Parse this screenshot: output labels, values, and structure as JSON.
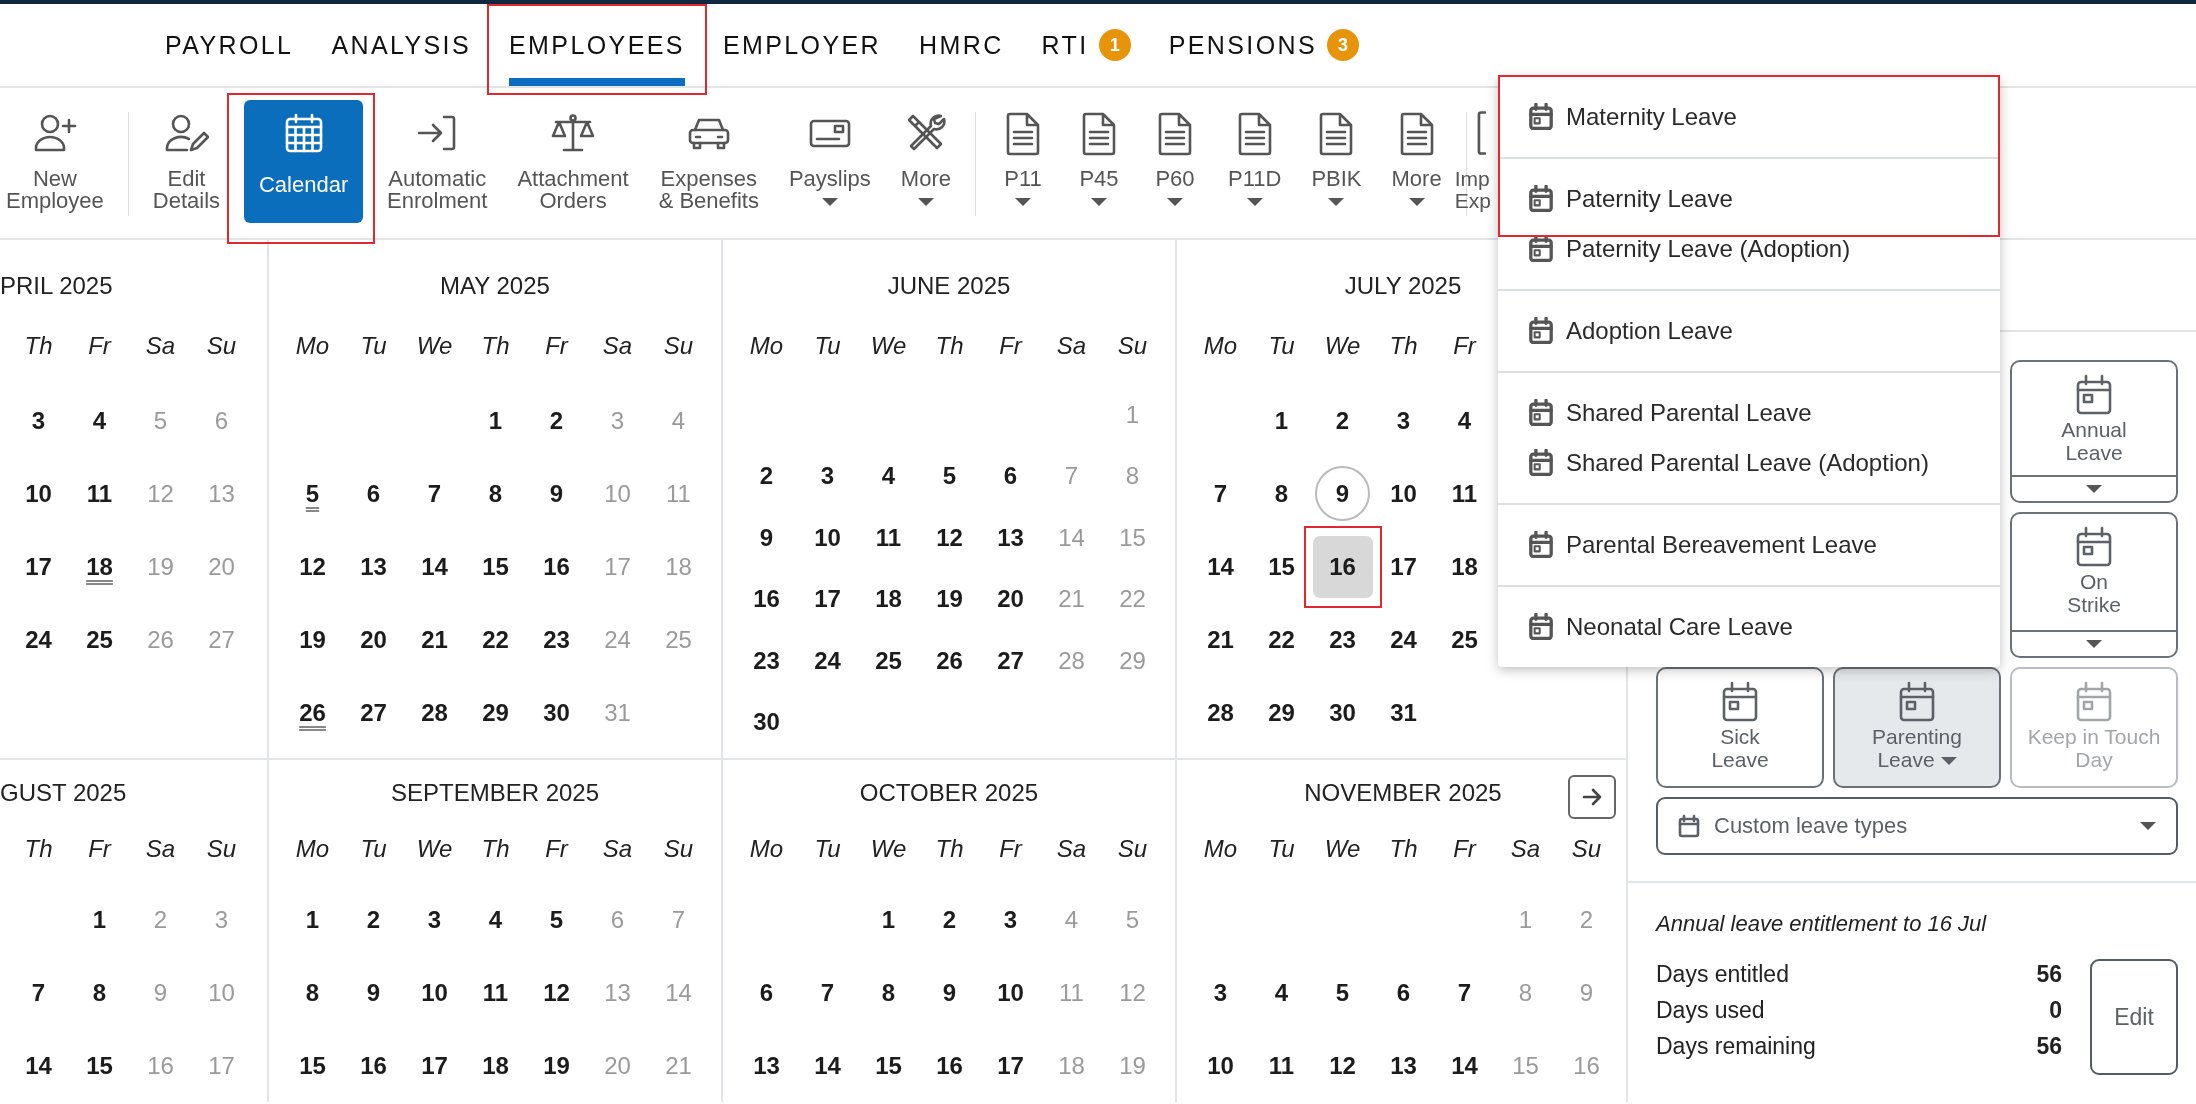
{
  "nav": {
    "tabs": [
      {
        "label": "PAYROLL",
        "selected": false,
        "highlighted": false
      },
      {
        "label": "ANALYSIS",
        "selected": false,
        "highlighted": false
      },
      {
        "label": "EMPLOYEES",
        "selected": true,
        "highlighted": true
      },
      {
        "label": "EMPLOYER",
        "selected": false,
        "highlighted": false
      },
      {
        "label": "HMRC",
        "selected": false,
        "highlighted": false
      },
      {
        "label": "RTI",
        "selected": false,
        "highlighted": false,
        "badge": "1"
      },
      {
        "label": "PENSIONS",
        "selected": false,
        "highlighted": false,
        "badge": "3"
      }
    ]
  },
  "toolbar": {
    "groups": [
      [
        {
          "label": "New\nEmployee",
          "selected": false,
          "dropdown": false,
          "highlighted": false
        }
      ],
      [
        {
          "label": "Edit\nDetails",
          "selected": false,
          "dropdown": false,
          "highlighted": false
        },
        {
          "label": "Calendar",
          "selected": true,
          "dropdown": false,
          "highlighted": true
        },
        {
          "label": "Automatic\nEnrolment",
          "selected": false,
          "dropdown": false,
          "highlighted": false
        },
        {
          "label": "Attachment\nOrders",
          "selected": false,
          "dropdown": false,
          "highlighted": false
        },
        {
          "label": "Expenses\n& Benefits",
          "selected": false,
          "dropdown": false,
          "highlighted": false
        },
        {
          "label": "Payslips",
          "selected": false,
          "dropdown": true,
          "highlighted": false
        },
        {
          "label": "More",
          "selected": false,
          "dropdown": true,
          "highlighted": false
        }
      ],
      [
        {
          "label": "P11",
          "selected": false,
          "dropdown": true,
          "highlighted": false
        },
        {
          "label": "P45",
          "selected": false,
          "dropdown": true,
          "highlighted": false
        },
        {
          "label": "P60",
          "selected": false,
          "dropdown": true,
          "highlighted": false
        },
        {
          "label": "P11D",
          "selected": false,
          "dropdown": true,
          "highlighted": false
        },
        {
          "label": "PBIK",
          "selected": false,
          "dropdown": true,
          "highlighted": false
        },
        {
          "label": "More",
          "selected": false,
          "dropdown": true,
          "highlighted": false
        }
      ],
      [
        {
          "label": "Imp\nExp",
          "selected": false,
          "dropdown": false,
          "highlighted": false
        }
      ]
    ]
  },
  "calendar": {
    "rows": [
      {
        "months": [
          {
            "title": "PRIL 2025",
            "weekdays": [
              {
                "label": "Th",
                "weekend": false
              },
              {
                "label": "Fr",
                "weekend": false
              },
              {
                "label": "Sa",
                "weekend": true
              },
              {
                "label": "Su",
                "weekend": true
              }
            ],
            "weeks": [
              [
                "3",
                "4",
                "5",
                "6"
              ],
              [
                "10",
                "11",
                "12",
                "13"
              ],
              [
                "17",
                {
                  "day": "18",
                  "holiday": true,
                  "selected": false
                },
                "19",
                "20"
              ],
              [
                "24",
                "25",
                "26",
                "27"
              ]
            ]
          },
          {
            "title": "MAY 2025",
            "weekdays": [
              {
                "label": "Mo",
                "weekend": false
              },
              {
                "label": "Tu",
                "weekend": false
              },
              {
                "label": "We",
                "weekend": false
              },
              {
                "label": "Th",
                "weekend": false
              },
              {
                "label": "Fr",
                "weekend": false
              },
              {
                "label": "Sa",
                "weekend": true
              },
              {
                "label": "Su",
                "weekend": true
              }
            ],
            "weeks": [
              [
                "1",
                "2",
                "3",
                "4"
              ],
              [
                {
                  "day": "5",
                  "holiday": true,
                  "selected": false
                },
                "6",
                "7",
                "8",
                "9",
                "10",
                "11"
              ],
              [
                "12",
                "13",
                "14",
                "15",
                "16",
                "17",
                "18"
              ],
              [
                "19",
                "20",
                "21",
                "22",
                "23",
                "24",
                "25"
              ],
              [
                {
                  "day": "26",
                  "holiday": true,
                  "selected": false
                },
                "27",
                "28",
                "29",
                "30",
                "31"
              ]
            ]
          },
          {
            "title": "JUNE 2025",
            "weekdays": [
              {
                "label": "Mo",
                "weekend": false
              },
              {
                "label": "Tu",
                "weekend": false
              },
              {
                "label": "We",
                "weekend": false
              },
              {
                "label": "Th",
                "weekend": false
              },
              {
                "label": "Fr",
                "weekend": false
              },
              {
                "label": "Sa",
                "weekend": true
              },
              {
                "label": "Su",
                "weekend": true
              }
            ],
            "weeks": [
              [
                "1"
              ],
              [
                "2",
                "3",
                "4",
                "5",
                "6",
                "7",
                "8"
              ],
              [
                "9",
                "10",
                "11",
                "12",
                "13",
                "14",
                "15"
              ],
              [
                "16",
                "17",
                "18",
                "19",
                "20",
                "21",
                "22"
              ],
              [
                "23",
                "24",
                "25",
                "26",
                "27",
                "28",
                "29"
              ],
              [
                "30"
              ]
            ]
          },
          {
            "title": "JULY 2025",
            "weekdays": [
              {
                "label": "Mo",
                "weekend": false
              },
              {
                "label": "Tu",
                "weekend": false
              },
              {
                "label": "We",
                "weekend": false
              },
              {
                "label": "Th",
                "weekend": false
              },
              {
                "label": "Fr",
                "weekend": false
              }
            ],
            "weeks": [
              [
                "1",
                "2",
                "3",
                "4"
              ],
              [
                "7",
                "8",
                {
                  "day": "9",
                  "today": true,
                  "selected": false
                },
                "10",
                "11"
              ],
              [
                "14",
                "15",
                {
                  "day": "16",
                  "selected": true,
                  "highlighted": true
                },
                "17",
                "18"
              ],
              [
                "21",
                "22",
                "23",
                "24",
                "25"
              ],
              [
                "28",
                "29",
                "30",
                "31"
              ]
            ]
          }
        ]
      },
      {
        "months": [
          {
            "title": "GUST 2025",
            "weekdays": [
              {
                "label": "Th",
                "weekend": false
              },
              {
                "label": "Fr",
                "weekend": false
              },
              {
                "label": "Sa",
                "weekend": true
              },
              {
                "label": "Su",
                "weekend": true
              }
            ],
            "weeks": [
              [
                "1",
                "2",
                "3"
              ],
              [
                "7",
                "8",
                "9",
                "10"
              ],
              [
                "14",
                "15",
                "16",
                "17"
              ]
            ]
          },
          {
            "title": "SEPTEMBER 2025",
            "weekdays": [
              {
                "label": "Mo",
                "weekend": false
              },
              {
                "label": "Tu",
                "weekend": false
              },
              {
                "label": "We",
                "weekend": false
              },
              {
                "label": "Th",
                "weekend": false
              },
              {
                "label": "Fr",
                "weekend": false
              },
              {
                "label": "Sa",
                "weekend": true
              },
              {
                "label": "Su",
                "weekend": true
              }
            ],
            "weeks": [
              [
                "1",
                "2",
                "3",
                "4",
                "5",
                "6",
                "7"
              ],
              [
                "8",
                "9",
                "10",
                "11",
                "12",
                "13",
                "14"
              ],
              [
                "15",
                "16",
                "17",
                "18",
                "19",
                "20",
                "21"
              ]
            ]
          },
          {
            "title": "OCTOBER 2025",
            "weekdays": [
              {
                "label": "Mo",
                "weekend": false
              },
              {
                "label": "Tu",
                "weekend": false
              },
              {
                "label": "We",
                "weekend": false
              },
              {
                "label": "Th",
                "weekend": false
              },
              {
                "label": "Fr",
                "weekend": false
              },
              {
                "label": "Sa",
                "weekend": true
              },
              {
                "label": "Su",
                "weekend": true
              }
            ],
            "weeks": [
              [
                "1",
                "2",
                "3",
                "4",
                "5"
              ],
              [
                "6",
                "7",
                "8",
                "9",
                "10",
                "11",
                "12"
              ],
              [
                "13",
                "14",
                "15",
                "16",
                "17",
                "18",
                "19"
              ]
            ]
          },
          {
            "title": "NOVEMBER 2025",
            "next_button": true,
            "weekdays": [
              {
                "label": "Mo",
                "weekend": false
              },
              {
                "label": "Tu",
                "weekend": false
              },
              {
                "label": "We",
                "weekend": false
              },
              {
                "label": "Th",
                "weekend": false
              },
              {
                "label": "Fr",
                "weekend": false
              },
              {
                "label": "Sa",
                "weekend": true
              },
              {
                "label": "Su",
                "weekend": true
              }
            ],
            "weeks": [
              [
                "1",
                "2"
              ],
              [
                "3",
                "4",
                "5",
                "6",
                "7",
                "8",
                "9"
              ],
              [
                "10",
                "11",
                "12",
                "13",
                "14",
                "15",
                "16"
              ]
            ]
          }
        ]
      }
    ]
  },
  "leave_panel": {
    "leave_types": [
      {
        "label": "Annual\nLeave",
        "kind": "split",
        "selected": false,
        "disabled": false
      },
      {
        "label": "On\nStrike",
        "kind": "split",
        "selected": false,
        "disabled": false
      },
      {
        "label": "Sick\nLeave",
        "kind": "plain",
        "selected": false,
        "disabled": false
      },
      {
        "label": "Parenting\nLeave",
        "kind": "menu",
        "selected": true,
        "disabled": false
      },
      {
        "label": "Keep in Touch\nDay",
        "kind": "plain",
        "selected": false,
        "disabled": true
      }
    ],
    "custom_select": {
      "label": "Custom leave types"
    },
    "entitlement": {
      "title": "Annual leave entitlement to 16 Jul",
      "rows": [
        {
          "label": "Days entitled",
          "value": "56"
        },
        {
          "label": "Days used",
          "value": "0"
        },
        {
          "label": "Days remaining",
          "value": "56"
        }
      ],
      "edit_button": "Edit"
    }
  },
  "parenting_menu": {
    "sections": [
      {
        "items": [
          {
            "label": "Maternity Leave",
            "highlighted": true
          }
        ]
      },
      {
        "items": [
          {
            "label": "Paternity Leave",
            "highlighted": true
          },
          {
            "label": "Paternity Leave (Adoption)",
            "highlighted": false
          }
        ]
      },
      {
        "items": [
          {
            "label": "Adoption Leave",
            "highlighted": false
          }
        ]
      },
      {
        "items": [
          {
            "label": "Shared Parental Leave",
            "highlighted": false
          },
          {
            "label": "Shared Parental Leave (Adoption)",
            "highlighted": false
          }
        ]
      },
      {
        "items": [
          {
            "label": "Parental Bereavement Leave",
            "highlighted": false
          }
        ]
      },
      {
        "items": [
          {
            "label": "Neonatal Care Leave",
            "highlighted": false
          }
        ]
      }
    ]
  }
}
